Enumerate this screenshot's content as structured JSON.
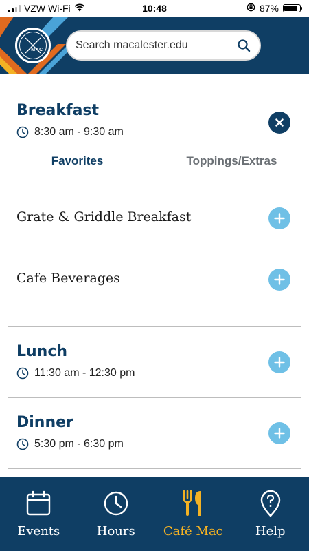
{
  "status_bar": {
    "carrier": "VZW Wi-Fi",
    "time": "10:48",
    "battery": "87%",
    "battery_level": 0.87
  },
  "header": {
    "logo_text": "MAC",
    "search": {
      "placeholder": "Search macalester.edu"
    }
  },
  "meals": {
    "breakfast": {
      "title": "Breakfast",
      "time": "8:30 am - 9:30 am",
      "tabs": [
        "Favorites",
        "Toppings/Extras"
      ],
      "categories": [
        "Grate & Griddle Breakfast",
        "Cafe Beverages"
      ]
    },
    "lunch": {
      "title": "Lunch",
      "time": "11:30 am - 12:30 pm"
    },
    "dinner": {
      "title": "Dinner",
      "time": "5:30 pm - 6:30 pm"
    }
  },
  "nav": {
    "items": [
      {
        "label": "Events",
        "icon": "calendar-icon"
      },
      {
        "label": "Hours",
        "icon": "clock-icon"
      },
      {
        "label": "Café Mac",
        "icon": "fork-knife-icon"
      },
      {
        "label": "Help",
        "icon": "help-pin-icon"
      }
    ]
  },
  "colors": {
    "navy": "#0f3e64",
    "light_blue": "#6fc0e6",
    "gold": "#f4b224",
    "orange": "#e06a1f"
  }
}
